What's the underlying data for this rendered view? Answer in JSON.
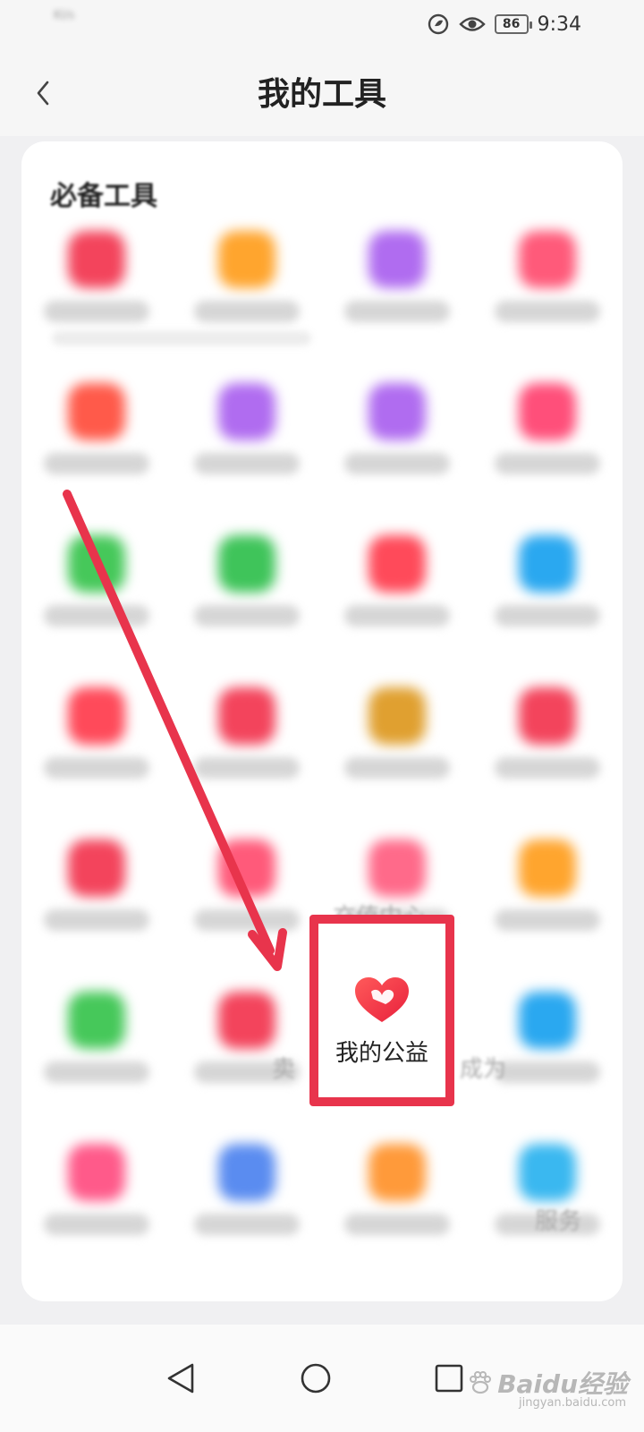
{
  "status_bar": {
    "net_speed": "Kl/s",
    "battery": "86",
    "time": "9:34"
  },
  "header": {
    "title": "我的工具"
  },
  "section": {
    "title": "必备工具"
  },
  "tools": [
    {
      "color": "#f3445c"
    },
    {
      "color": "#ffa52e"
    },
    {
      "color": "#b06cf0"
    },
    {
      "color": "#ff5a7a"
    },
    {
      "color": "#ff5a4a"
    },
    {
      "color": "#b06cf0"
    },
    {
      "color": "#b06cf0"
    },
    {
      "color": "#ff4f7a"
    },
    {
      "color": "#46c85a"
    },
    {
      "color": "#3fc45a"
    },
    {
      "color": "#ff4a5a"
    },
    {
      "color": "#2aa8f0"
    },
    {
      "color": "#ff4a5a"
    },
    {
      "color": "#f3445c"
    },
    {
      "color": "#e0a030"
    },
    {
      "color": "#f3445c"
    },
    {
      "color": "#f3445c"
    },
    {
      "color": "#ff5a7a"
    },
    {
      "color": "#ff6a8a"
    },
    {
      "color": "#ffa52e"
    },
    {
      "color": "#46c85a"
    },
    {
      "color": "#f3445c"
    },
    {
      "color": "#ffffff"
    },
    {
      "color": "#2aa8f0"
    },
    {
      "color": "#ff5a8a"
    },
    {
      "color": "#5a8cf0"
    },
    {
      "color": "#ff9a3a"
    },
    {
      "color": "#3ab8f0"
    }
  ],
  "partial_labels": {
    "recharge": "充值中心",
    "sell_suffix": "卖",
    "become_prefix": "成为",
    "service_suffix": "服务"
  },
  "highlight": {
    "label": "我的公益",
    "border_color": "#e8344c"
  },
  "watermark": {
    "brand": "Baidu经验",
    "url": "jingyan.baidu.com"
  }
}
